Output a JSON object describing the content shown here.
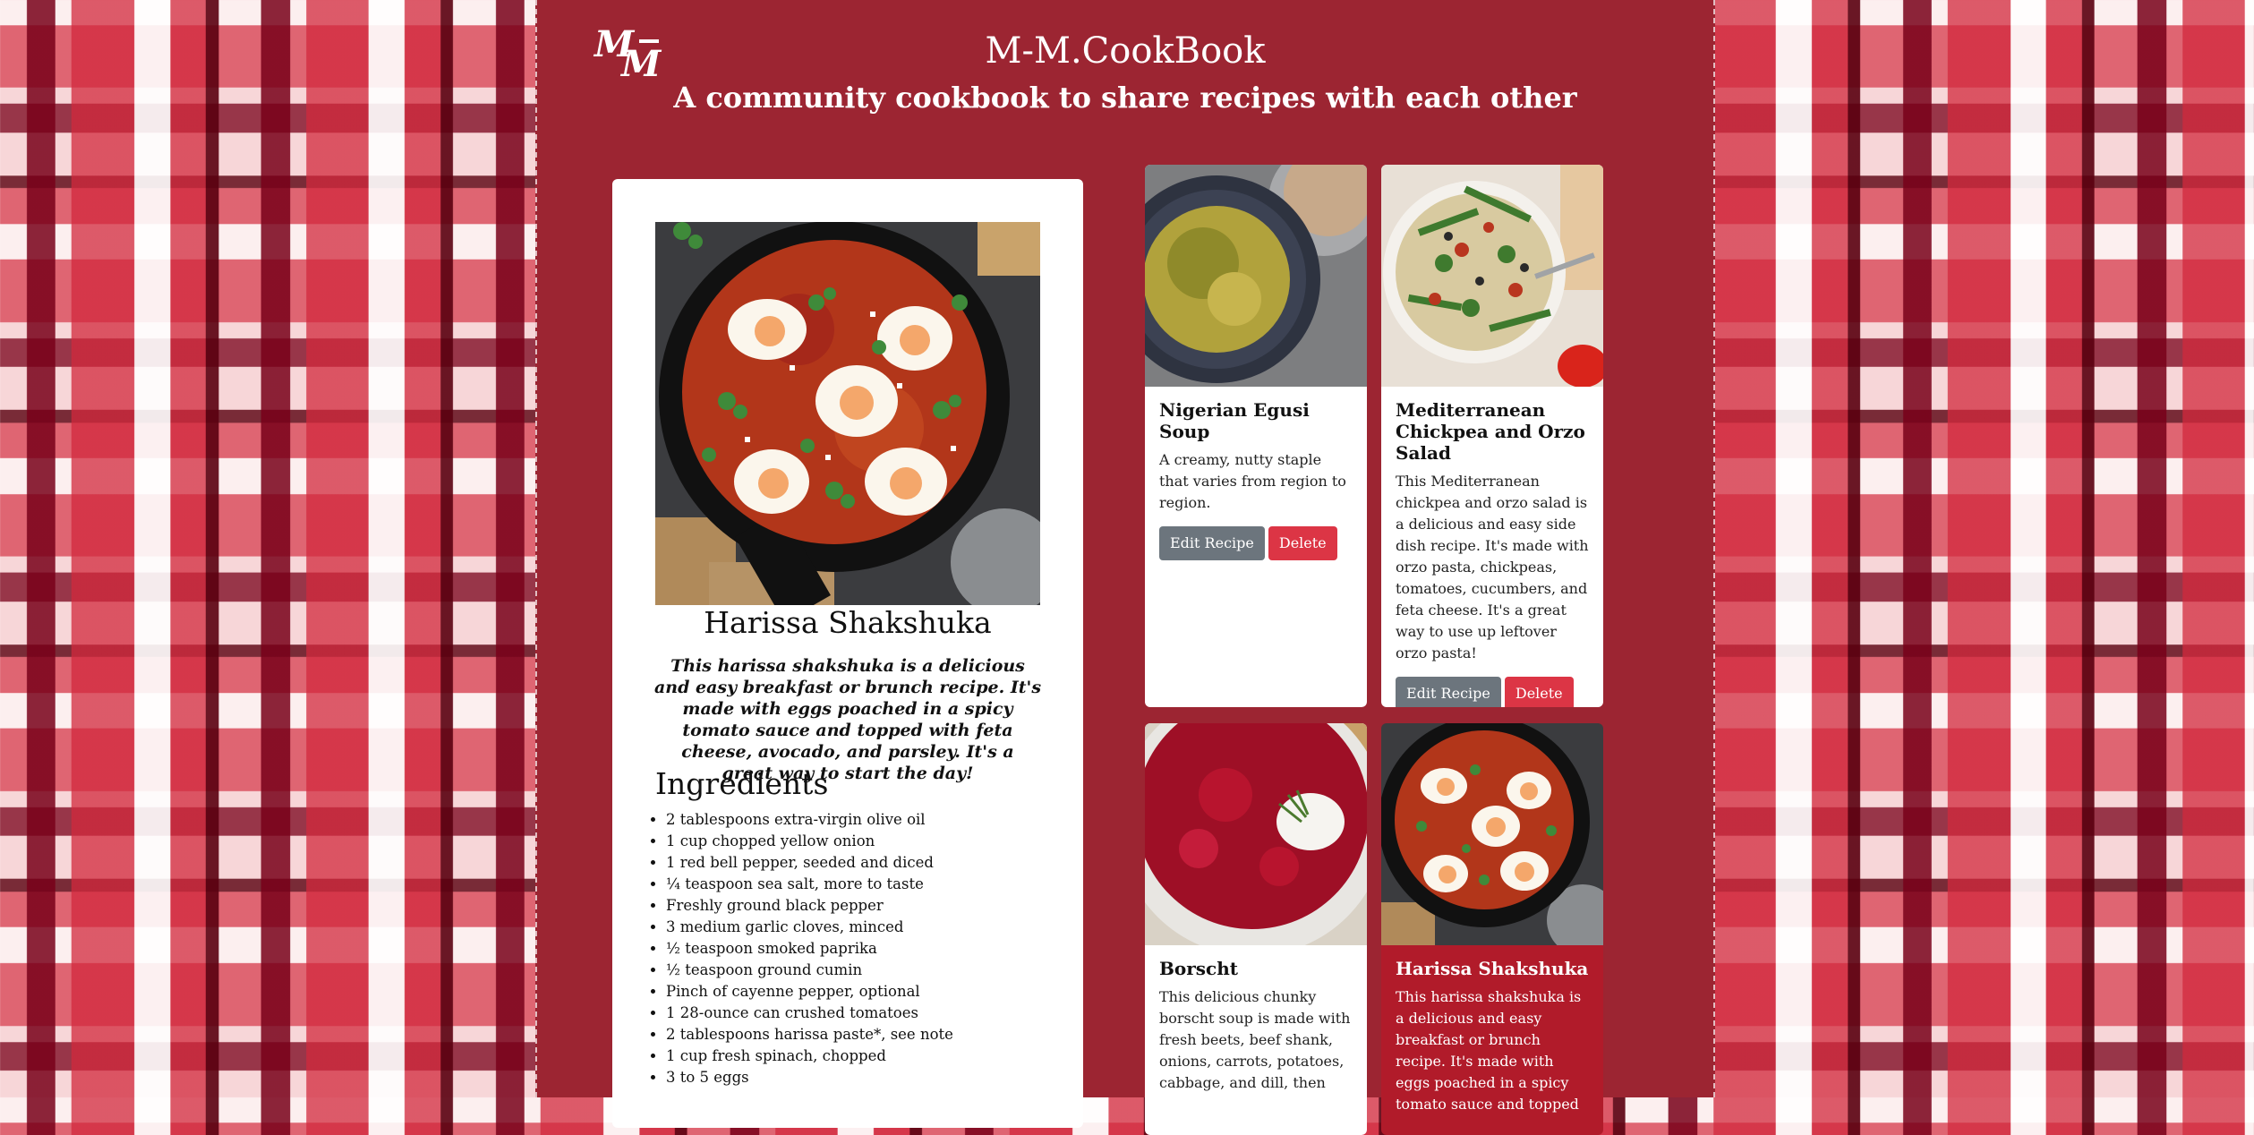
{
  "header": {
    "logo_text": "MM",
    "title": "M-M.CookBook",
    "subtitle": "A community cookbook to share recipes with each other"
  },
  "featured": {
    "image": "shakshuka-skillet-photo",
    "title": "Harissa Shakshuka",
    "description": "This harissa shakshuka is a delicious and easy breakfast or brunch recipe. It's made with eggs poached in a spicy tomato sauce and topped with feta cheese, avocado, and parsley. It's a great way to start the day!",
    "ingredients_heading": "Ingredients",
    "ingredients": [
      "2 tablespoons extra-virgin olive oil",
      "1 cup chopped yellow onion",
      "1 red bell pepper, seeded and diced",
      "¼ teaspoon sea salt, more to taste",
      "Freshly ground black pepper",
      "3 medium garlic cloves, minced",
      "½ teaspoon smoked paprika",
      "½ teaspoon ground cumin",
      "Pinch of cayenne pepper, optional",
      "1 28-ounce can crushed tomatoes",
      "2 tablespoons harissa paste*, see note",
      "1 cup fresh spinach, chopped",
      "3 to 5 eggs"
    ]
  },
  "cards": [
    {
      "image": "egusi-soup-bowl-photo",
      "title": "Nigerian Egusi Soup",
      "description": "A creamy, nutty staple that varies from region to region.",
      "edit_label": "Edit Recipe",
      "delete_label": "Delete"
    },
    {
      "image": "chickpea-orzo-salad-photo",
      "title": "Mediterranean Chickpea and Orzo Salad",
      "description": "This Mediterranean chickpea and orzo salad is a delicious and easy side dish recipe. It's made with orzo pasta, chickpeas, tomatoes, cucumbers, and feta cheese. It's a great way to use up leftover orzo pasta!",
      "edit_label": "Edit Recipe",
      "delete_label": "Delete"
    },
    {
      "image": "borscht-bowl-photo",
      "title": "Borscht",
      "description": "This delicious chunky borscht soup is made with fresh beets, beef shank, onions, carrots, potatoes, cabbage, and dill, then"
    },
    {
      "image": "shakshuka-skillet-photo",
      "title": "Harissa Shakshuka",
      "description": "This harissa shakshuka is a delicious and easy breakfast or brunch recipe. It's made with eggs poached in a spicy tomato sauce and topped"
    }
  ],
  "colors": {
    "center_bg": "#9c2532",
    "edit_button": "#6c757d",
    "delete_button": "#dc3545",
    "highlight_card": "#b11b2a"
  }
}
